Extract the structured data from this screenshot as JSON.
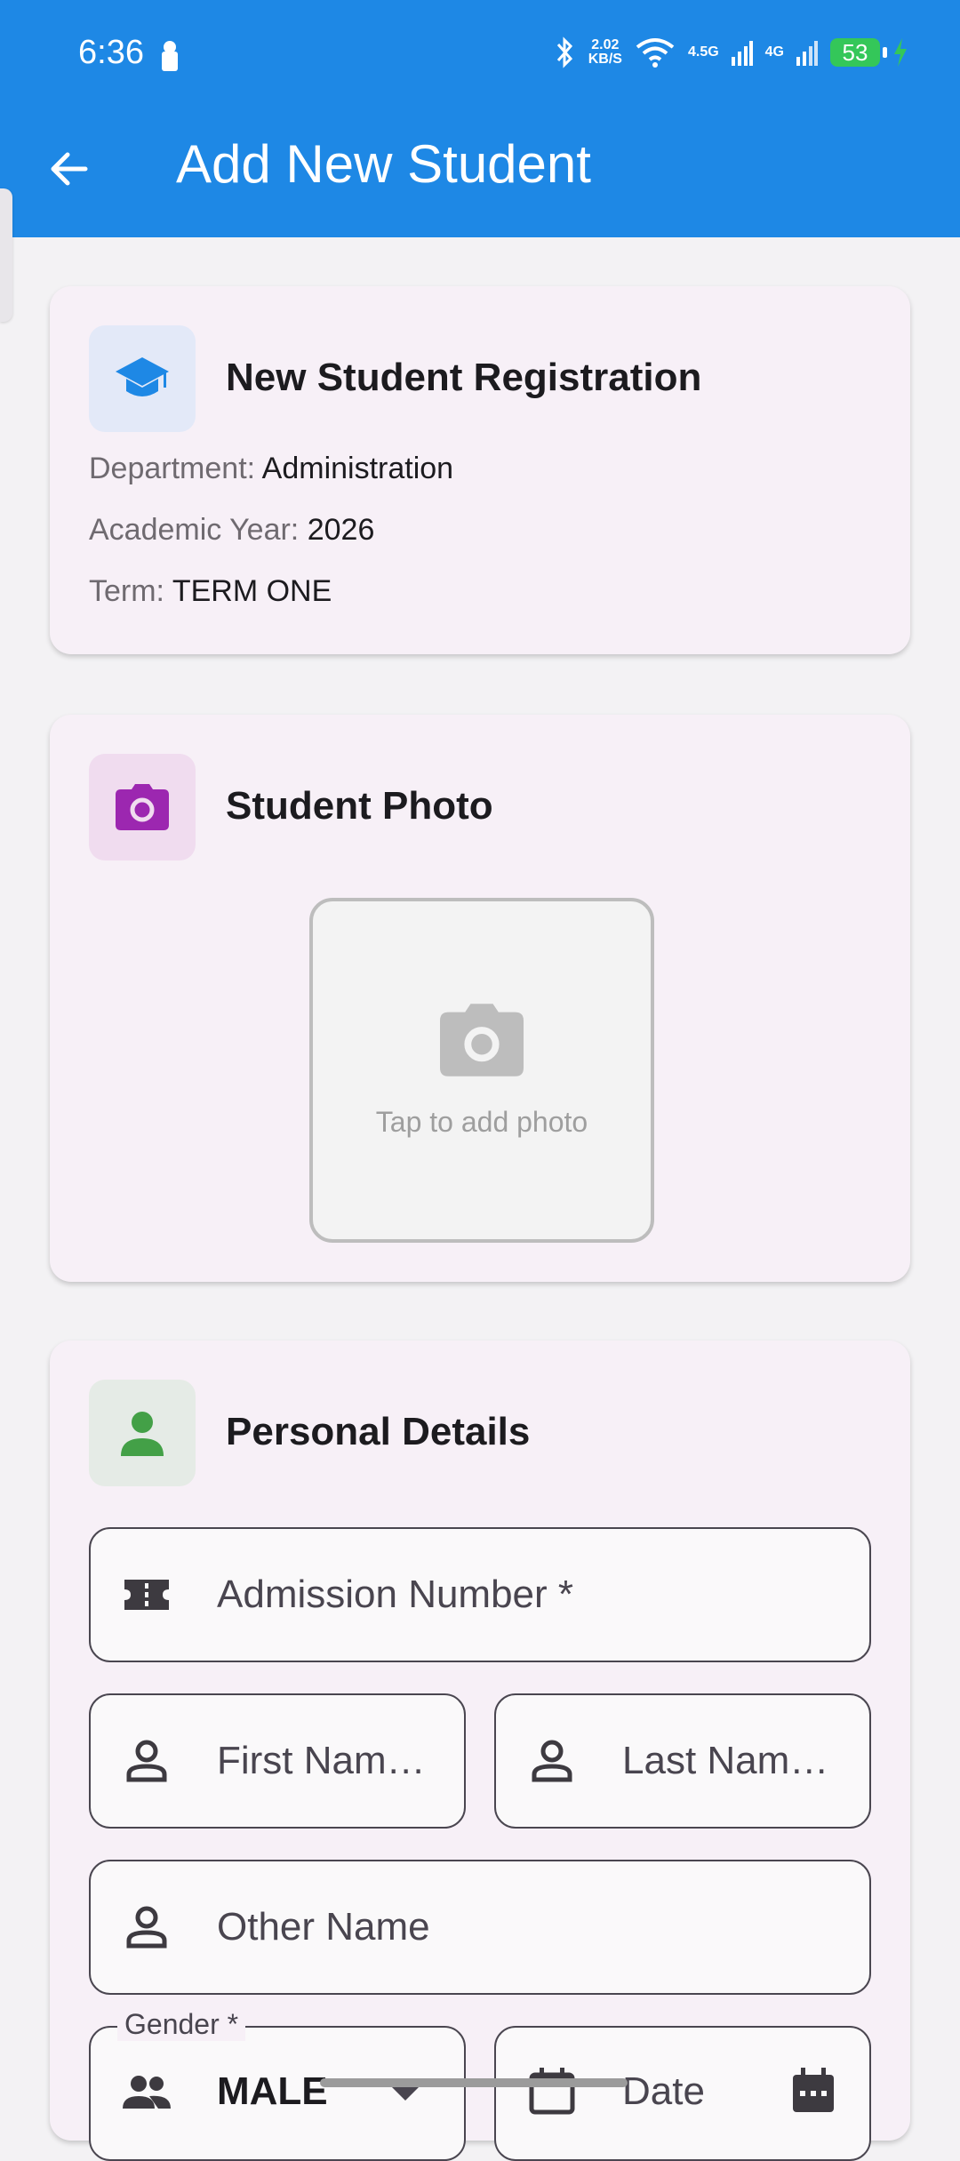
{
  "status_bar": {
    "time": "6:36",
    "speed_value": "2.02",
    "speed_unit": "KB/S",
    "net1": "4.5G",
    "net2": "4G",
    "battery": "53"
  },
  "app_bar": {
    "title": "Add New Student",
    "back_icon": "arrow-left-icon"
  },
  "registration": {
    "title": "New Student Registration",
    "department_label": "Department:",
    "department_value": "Administration",
    "year_label": "Academic Year:",
    "year_value": "2026",
    "term_label": "Term:",
    "term_value": "TERM ONE"
  },
  "photo": {
    "title": "Student Photo",
    "hint": "Tap to add photo"
  },
  "personal": {
    "title": "Personal Details",
    "admission_label": "Admission Number *",
    "first_name_label": "First Nam…",
    "last_name_label": "Last Nam…",
    "other_name_label": "Other Name",
    "gender_label": "Gender *",
    "gender_value": "MALE",
    "date_label": "Date"
  },
  "colors": {
    "primary": "#1e88e5",
    "purple": "#9c27b0",
    "green": "#43a047"
  }
}
